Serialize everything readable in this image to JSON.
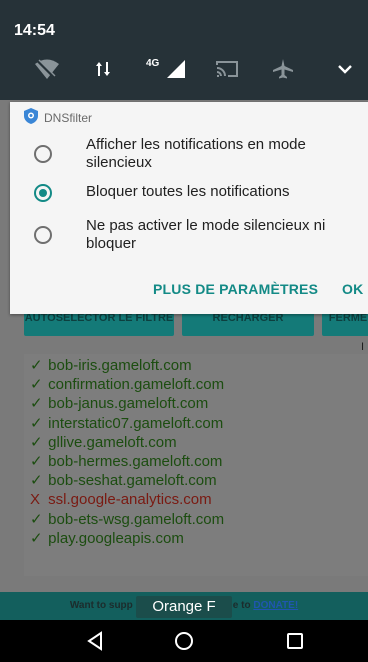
{
  "status_bar": {
    "time": "14:54",
    "quick_settings_icons": [
      "wifi-off-icon",
      "data-arrows-icon",
      "4g-signal-icon",
      "cast-icon",
      "airplane-mode-icon",
      "expand-chevron-icon"
    ],
    "network_type": "4G"
  },
  "notification": {
    "app_name": "DNSfilter",
    "options": [
      {
        "label": "Afficher les notifications en mode silencieux",
        "checked": false
      },
      {
        "label": "Bloquer toutes les notifications",
        "checked": true
      },
      {
        "label": "Ne pas activer le mode silencieux ni bloquer",
        "checked": false
      }
    ],
    "more_settings_label": "PLUS DE PARAMÈTRES",
    "ok_label": "OK",
    "accent_color": "#138a86"
  },
  "background_app": {
    "buttons": [
      "AUTOSELECTOR LE FILTRE",
      "RECHARGER",
      "FERMER"
    ],
    "marker": "I",
    "domains": [
      {
        "mark": "✓",
        "domain": "bob-iris.gameloft.com",
        "status": "allowed"
      },
      {
        "mark": "✓",
        "domain": "confirmation.gameloft.com",
        "status": "allowed"
      },
      {
        "mark": "✓",
        "domain": "bob-janus.gameloft.com",
        "status": "allowed"
      },
      {
        "mark": "✓",
        "domain": "interstatic07.gameloft.com",
        "status": "allowed"
      },
      {
        "mark": "✓",
        "domain": "gllive.gameloft.com",
        "status": "allowed"
      },
      {
        "mark": "✓",
        "domain": "bob-hermes.gameloft.com",
        "status": "allowed"
      },
      {
        "mark": "✓",
        "domain": "bob-seshat.gameloft.com",
        "status": "allowed"
      },
      {
        "mark": "X",
        "domain": "ssl.google-analytics.com",
        "status": "blocked"
      },
      {
        "mark": "✓",
        "domain": "bob-ets-wsg.gameloft.com",
        "status": "allowed"
      },
      {
        "mark": "✓",
        "domain": "play.googleapis.com",
        "status": "allowed"
      }
    ],
    "banner_prefix": "Want to supp",
    "banner_suffix": "e to",
    "banner_link": "DONATE!",
    "toast": "Orange F"
  },
  "navigation_bar": {
    "icons": [
      "back-icon",
      "home-icon",
      "recents-icon"
    ]
  }
}
